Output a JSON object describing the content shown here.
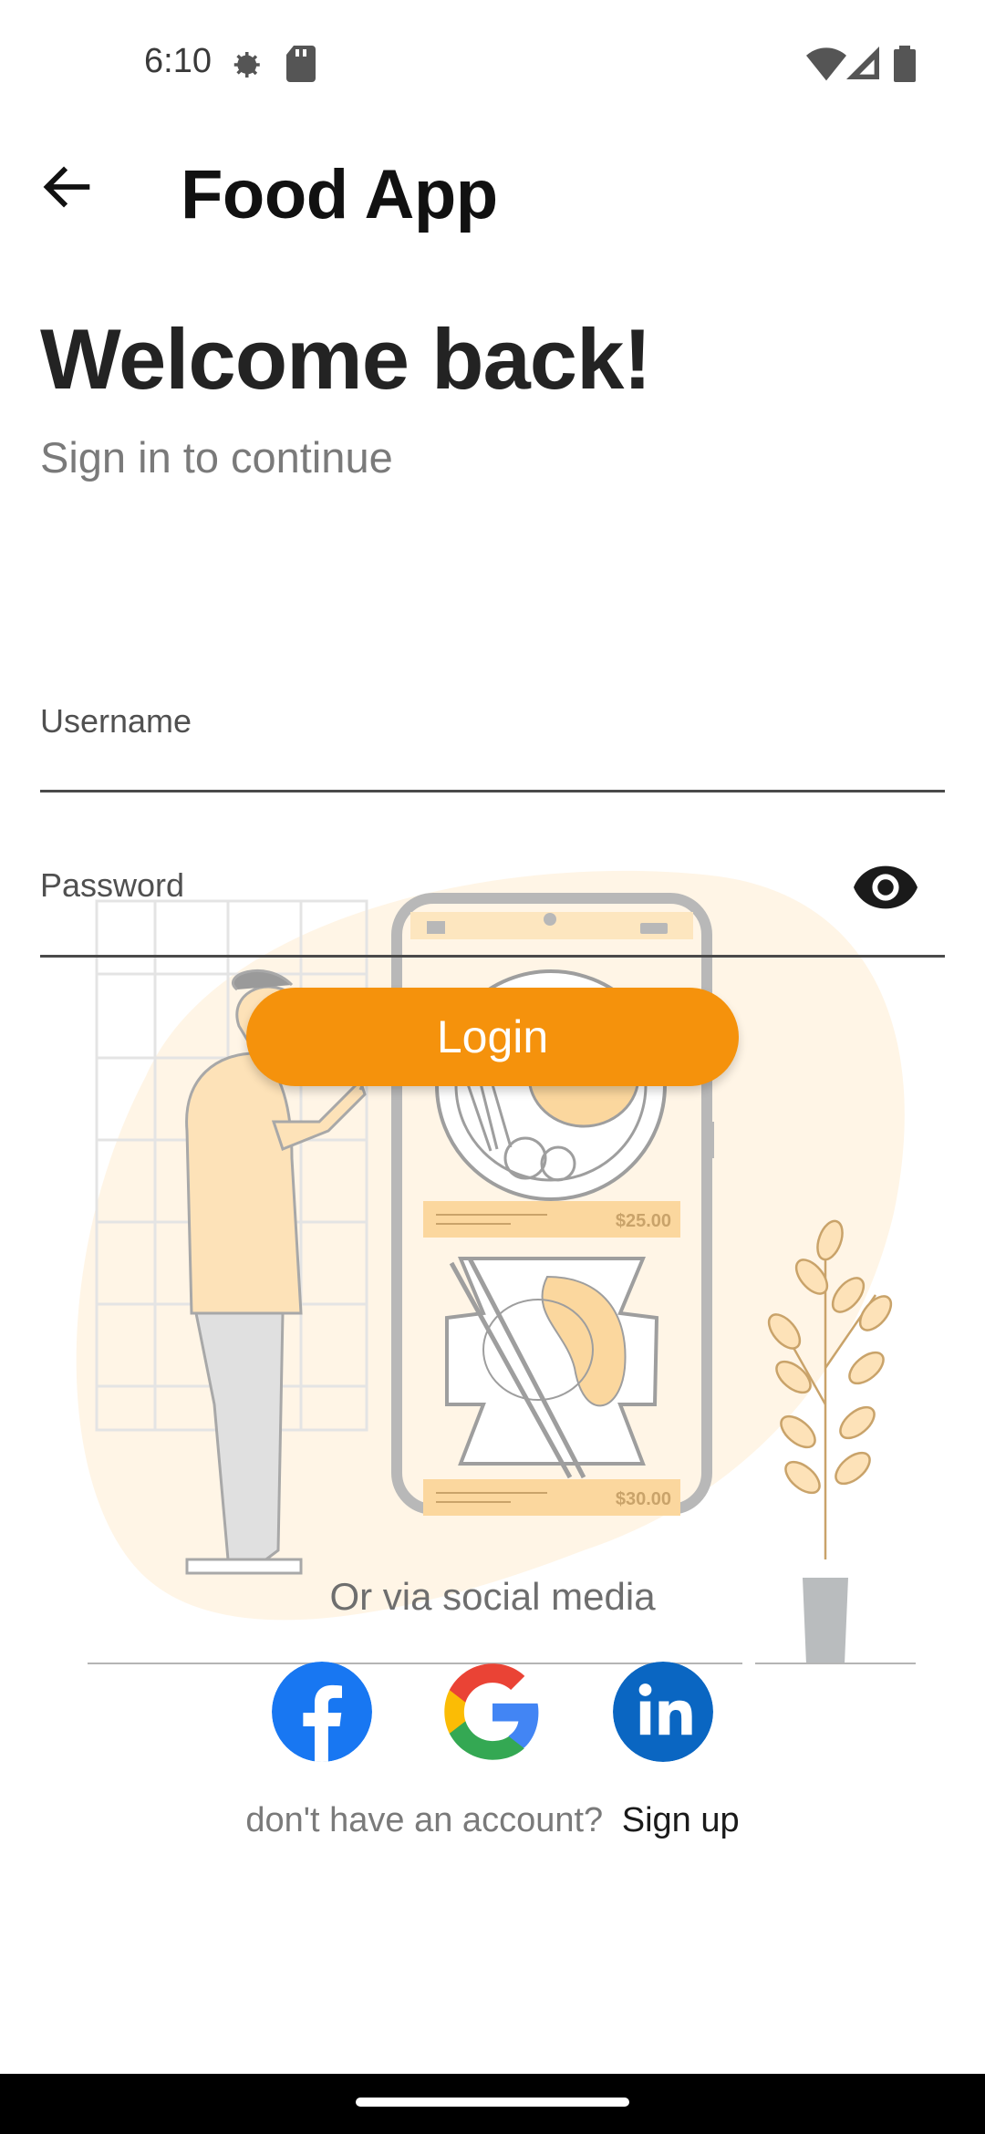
{
  "status_bar": {
    "time": "6:10"
  },
  "app_bar": {
    "title": "Food App"
  },
  "header": {
    "welcome": "Welcome back!",
    "subtitle": "Sign in to continue"
  },
  "form": {
    "username_label": "Username",
    "password_label": "Password",
    "login_label": "Login"
  },
  "illustration": {
    "price_top": "$25.00",
    "price_bottom": "$30.00"
  },
  "social": {
    "text": "Or via social media",
    "buttons": [
      "facebook-icon",
      "google-icon",
      "linkedin-icon"
    ]
  },
  "signup": {
    "prompt": "don't have an account?",
    "link": "Sign up"
  },
  "colors": {
    "accent": "#f5920c",
    "facebook": "#1877f2",
    "linkedin": "#0a66c2",
    "illustration_bg": "#fff5e6"
  }
}
